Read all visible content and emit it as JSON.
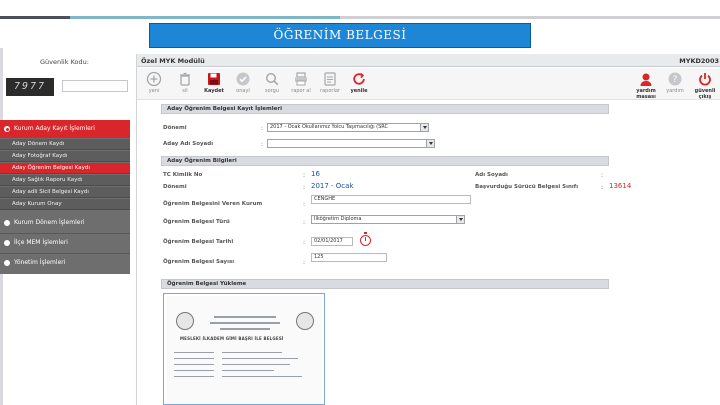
{
  "slide": {
    "title": "ÖĞRENİM BELGESİ"
  },
  "colors": {
    "accent_blue": "#1d86d6",
    "menu_red": "#d9262b",
    "menu_gray": "#6e6e6e",
    "value_blue": "#1e4fa8"
  },
  "login": {
    "security_label": "Güvenlik Kodu:",
    "captcha_text": "7977",
    "captcha_input_value": ""
  },
  "menu": {
    "groups": [
      {
        "label": "Kurum Aday Kayıt İşlemleri",
        "active": true
      },
      {
        "label": "Kurum Dönem İşlemleri",
        "active": false
      },
      {
        "label": "İlçe MEM İşlemleri",
        "active": false
      },
      {
        "label": "Yönetim İşlemleri",
        "active": false
      }
    ],
    "subitems": [
      {
        "label": "Aday Dönem Kaydı",
        "active": false
      },
      {
        "label": "Aday Fotoğraf Kaydı",
        "active": false
      },
      {
        "label": "Aday Öğrenim Belgesi Kaydı",
        "active": true
      },
      {
        "label": "Aday Sağlık Raporu Kaydı",
        "active": false
      },
      {
        "label": "Aday adli Sicil Belgesi Kaydı",
        "active": false
      },
      {
        "label": "Aday Kurum Onay",
        "active": false
      }
    ]
  },
  "module": {
    "title": "Özel MYK Modülü",
    "code": "MYKD2003"
  },
  "toolbar": {
    "buttons": [
      {
        "label": "yeni",
        "icon": "plus-circle-icon",
        "enabled": false
      },
      {
        "label": "sil",
        "icon": "trash-icon",
        "enabled": false
      },
      {
        "label": "Kaydet",
        "icon": "save-icon",
        "enabled": true
      },
      {
        "label": "onayl",
        "icon": "check-icon",
        "enabled": false
      },
      {
        "label": "sorgu",
        "icon": "search-icon",
        "enabled": false
      },
      {
        "label": "rapor al",
        "icon": "print-icon",
        "enabled": false
      },
      {
        "label": "raporlar",
        "icon": "reports-icon",
        "enabled": false
      },
      {
        "label": "yenile",
        "icon": "refresh-icon",
        "enabled": true
      }
    ],
    "right_buttons": [
      {
        "label": "yardım masası",
        "icon": "support-icon"
      },
      {
        "label": "yardım",
        "icon": "help-icon"
      },
      {
        "label": "güvenli çıkış",
        "icon": "power-icon"
      }
    ]
  },
  "registration": {
    "header": "Aday Öğrenim Belgesi Kayıt İşlemleri",
    "term_label": "Dönemi",
    "term_value": "2017 - Ocak Okullarımız Yolcu Taşımacılığı (SRC",
    "name_label": "Aday Adı Soyadı",
    "name_value": ""
  },
  "info": {
    "header": "Aday Öğrenim Bilgileri",
    "tc_label": "TC Kimlik No",
    "tc_value": "16",
    "term_label": "Dönemi",
    "term_value": "2017 - Ocak",
    "fullname_label": "Adı Soyadı",
    "fullname_value": "",
    "cert_no_label": "Başvurduğu Sürücü Belgesi Sınıfı",
    "cert_no_value": "13614",
    "issuer_label": "Öğrenim Belgesini Veren Kurum",
    "issuer_value": "CENGHE",
    "type_label": "Öğrenim Belgesi Türü",
    "type_value": "İlköğretim Diploma",
    "date_label": "Öğrenim Belgesi Tarihi",
    "date_value": "02/01/2017",
    "count_label": "Öğrenim Belgesi Sayısı",
    "count_value": "125"
  },
  "upload": {
    "header": "Öğrenim Belgesi Yükleme",
    "doc_heading": "MESLEKİ İLKADEM GİMİ BAŞRI İLE BELGESİ"
  }
}
